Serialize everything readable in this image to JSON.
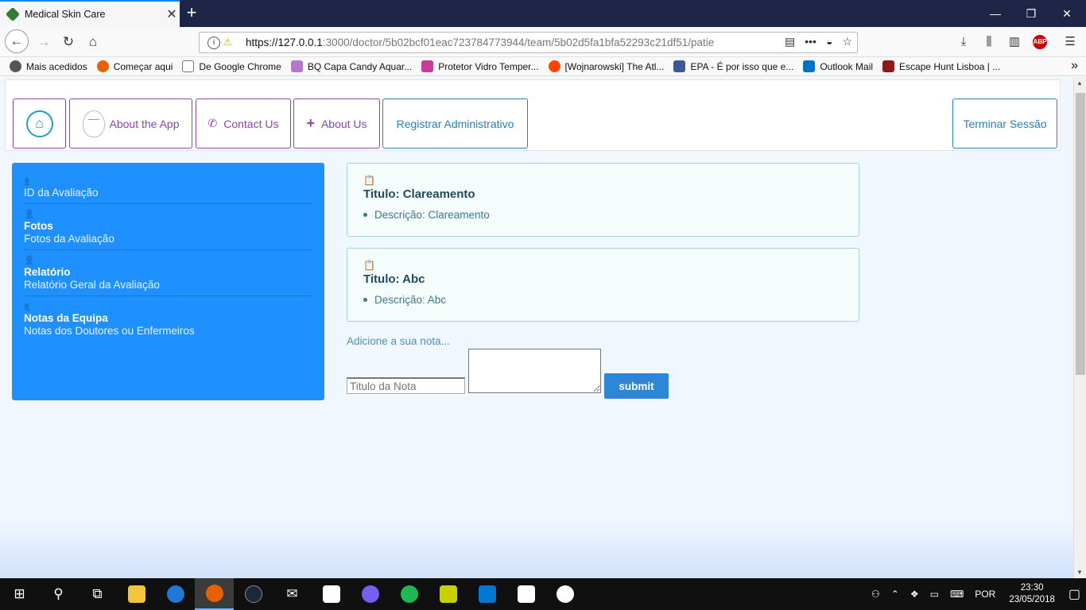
{
  "browser": {
    "tab_title": "Medical Skin Care",
    "url_host": "https://127.0.0.1",
    "url_rest": ":3000/doctor/5b02bcf01eac723784773944/team/5b02d5fa1bfa52293c21df51/patie",
    "abp_label": "ABP"
  },
  "bookmarks": [
    {
      "label": "Mais acedidos",
      "color": "#555555"
    },
    {
      "label": "Começar aqui",
      "color": "#e66000"
    },
    {
      "label": "De Google Chrome",
      "color": "#777777"
    },
    {
      "label": "BQ Capa Candy Aquar...",
      "color": "#b478c8"
    },
    {
      "label": "Protetor Vidro Temper...",
      "color": "#c83c9c"
    },
    {
      "label": "[Wojnarowski] The Atl...",
      "color": "#ff4500"
    },
    {
      "label": "EPA - É por isso que e...",
      "color": "#3b5998"
    },
    {
      "label": "Outlook Mail",
      "color": "#0072c6"
    },
    {
      "label": "Escape Hunt Lisboa | ...",
      "color": "#8b1a1a"
    }
  ],
  "nav": {
    "about_app": "About the App",
    "contact": "Contact Us",
    "about_us": "About Us",
    "register_admin": "Registrar Administrativo",
    "logout": "Terminar Sessão"
  },
  "sidebar": {
    "items": [
      {
        "title": "",
        "subtitle": "ID da Avaliação",
        "icon": "users-icon"
      },
      {
        "title": "Fotos",
        "subtitle": "Fotos da Avaliação",
        "icon": "user-icon"
      },
      {
        "title": "Relatório",
        "subtitle": "Relatório Geral da Avaliação",
        "icon": "user-icon"
      },
      {
        "title": "Notas da Equipa",
        "subtitle": "Notas dos Doutores ou Enfermeiros",
        "icon": "users-icon"
      }
    ]
  },
  "notes": [
    {
      "title": "Titulo: Clareamento",
      "description": "Descrição: Clareamento"
    },
    {
      "title": "Titulo: Abc",
      "description": "Descrição: Abc"
    }
  ],
  "form": {
    "prompt": "Adicione a sua nota...",
    "title_placeholder": "Titulo da Nota",
    "submit_label": "submit"
  },
  "tray": {
    "language": "POR",
    "time": "23:30",
    "date": "23/05/2018"
  },
  "colors": {
    "sidebar_bg": "#1e90ff",
    "accent_purple": "#8e44ad",
    "accent_blue": "#2980b9",
    "submit_bg": "#2d86d8"
  }
}
